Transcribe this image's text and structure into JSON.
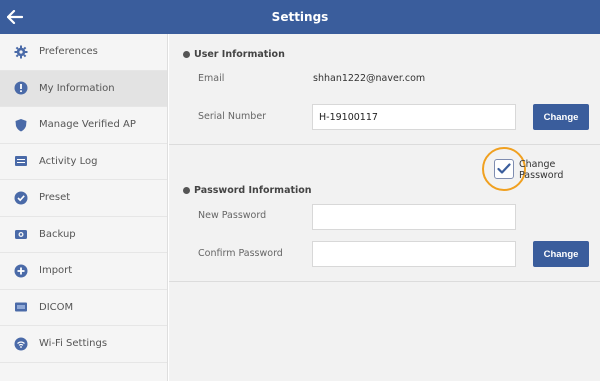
{
  "header": {
    "title": "Settings",
    "back_icon": "arrow-left-icon"
  },
  "sidebar": {
    "items": [
      {
        "label": "Preferences",
        "icon": "gear-icon"
      },
      {
        "label": "My Information",
        "icon": "user-icon",
        "active": true
      },
      {
        "label": "Manage Verified AP",
        "icon": "shield-icon"
      },
      {
        "label": "Activity Log",
        "icon": "log-icon"
      },
      {
        "label": "Preset",
        "icon": "check-circle-icon"
      },
      {
        "label": "Backup",
        "icon": "backup-icon"
      },
      {
        "label": "Import",
        "icon": "plus-circle-icon"
      },
      {
        "label": "DICOM",
        "icon": "dicom-icon"
      },
      {
        "label": "Wi-Fi Settings",
        "icon": "wifi-icon"
      }
    ]
  },
  "user_info": {
    "title": "User Information",
    "email_label": "Email",
    "email_value": "shhan1222@naver.com",
    "serial_label": "Serial Number",
    "serial_value": "H-19100117",
    "change_label": "Change"
  },
  "change_password": {
    "label": "Change Password",
    "checked": true
  },
  "password_info": {
    "title": "Password Information",
    "new_label": "New Password",
    "new_value": "",
    "confirm_label": "Confirm Password",
    "confirm_value": "",
    "change_label": "Change"
  },
  "colors": {
    "header": "#3a5d9c",
    "button": "#3a5d9c",
    "highlight_ring": "#f0a020"
  }
}
